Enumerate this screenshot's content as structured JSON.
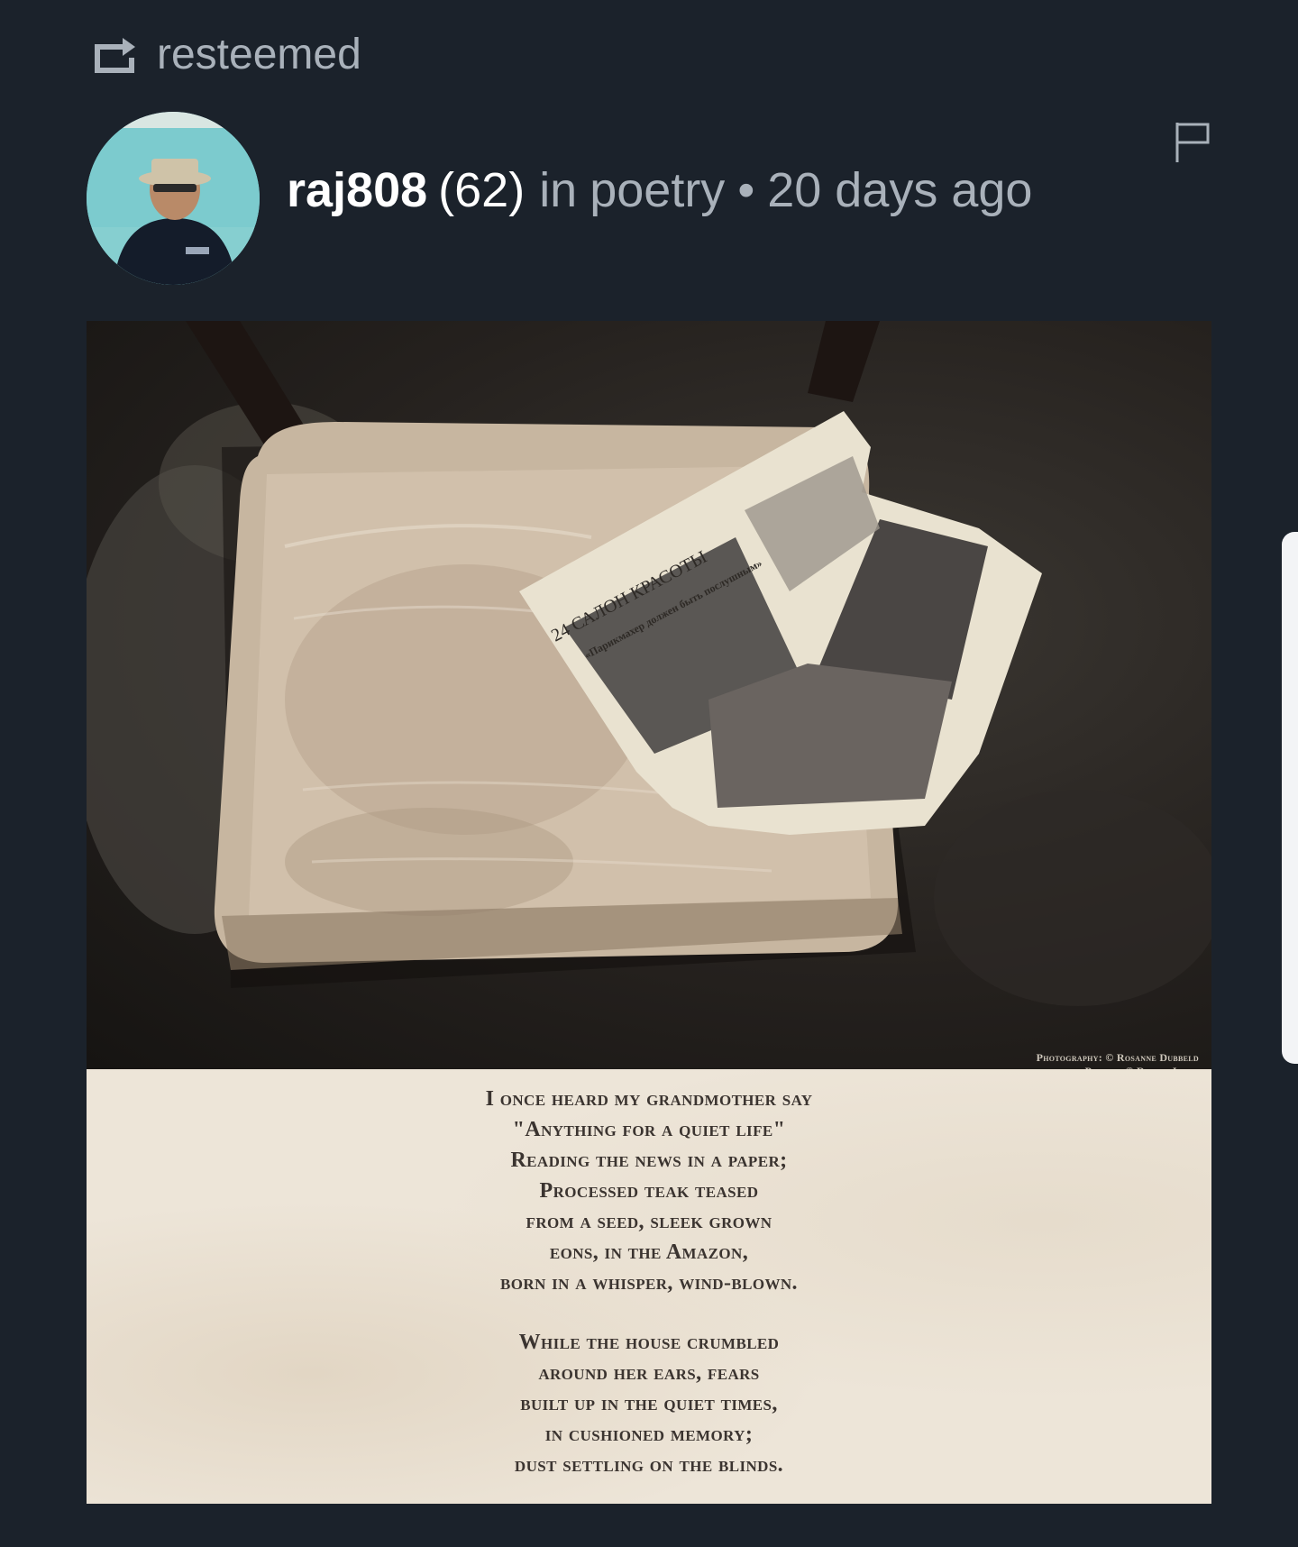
{
  "resteem": {
    "label": "resteemed",
    "icon": "resteem-icon"
  },
  "post": {
    "author": "raj808",
    "reputation": "(62)",
    "in_label": "in",
    "category": "poetry",
    "separator": "•",
    "age": "20 days ago"
  },
  "image": {
    "newspaper_headline": "24 САЛОН КРАСОТЫ",
    "newspaper_subhead": "«Парикмахер должен быть послушным»",
    "credits": {
      "photography": "Photography: © Rosanne Dubbeld",
      "poetry": "Poetry: © Rowan Joyce"
    },
    "poem": {
      "stanza1": [
        "I once heard my grandmother say",
        "\"Anything for a quiet life\"",
        "Reading the news in a paper;",
        "Processed teak teased",
        "from a seed, sleek grown",
        "eons, in the Amazon,",
        "born in a whisper, wind-blown."
      ],
      "stanza2": [
        "While the house crumbled",
        "around her ears, fears",
        "built up in the quiet times,",
        "in cushioned memory;",
        "dust settling on the blinds."
      ]
    }
  },
  "colors": {
    "background": "#1b222b",
    "muted_text": "#a9b1ba",
    "author_text": "#ffffff",
    "paper": "#ede5d8"
  }
}
